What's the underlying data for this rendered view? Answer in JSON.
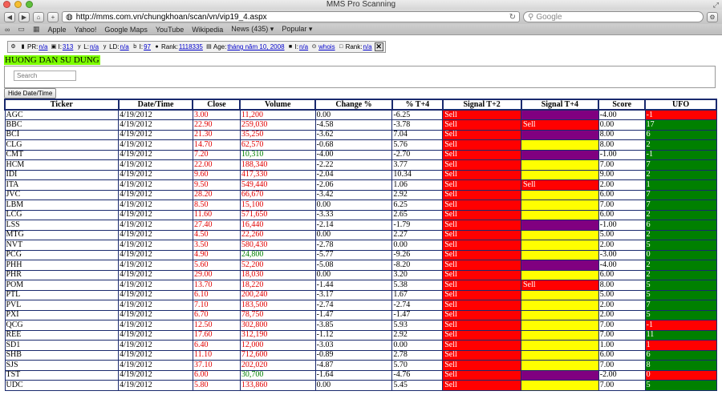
{
  "window": {
    "title": "MMS Pro Scanning"
  },
  "browser": {
    "url": "http://mms.com.vn/chungkhoan/scan/vn/vip19_4.aspx",
    "search_placeholder": "Google",
    "bookmarks": [
      "Apple",
      "Yahoo!",
      "Google Maps",
      "YouTube",
      "Wikipedia",
      "News (435)",
      "Popular"
    ]
  },
  "alexa": {
    "pr_label": "PR:",
    "pr_value": "n/a",
    "l1_label": "I:",
    "l1_value": "313",
    "l2_label": "L:",
    "l2_value": "n/a",
    "ld_label": "LD:",
    "ld_value": "n/a",
    "i_label": "I:",
    "i_value": "97",
    "rank_label": "Rank:",
    "rank_value": "1118335",
    "age_label": "Age:",
    "age_value": "tháng năm 10, 2008",
    "i2_label": "I:",
    "i2_value": "n/a",
    "whois": "whois",
    "rank2_label": "Rank:",
    "rank2_value": "n/a"
  },
  "page": {
    "guide_title": "HUONG DAN SU DUNG",
    "search_placeholder": "Search",
    "hide_button": "Hide Date/Time"
  },
  "table": {
    "headers": [
      "Ticker",
      "Date/Time",
      "Close",
      "Volume",
      "Change %",
      "% T+4",
      "Signal T+2",
      "Signal T+4",
      "Score",
      "UFO"
    ],
    "rows": [
      {
        "ticker": "AGC",
        "date": "4/19/2012",
        "close": "3.00",
        "close_color": "red",
        "volume": "11,200",
        "volume_color": "red",
        "change": "0.00",
        "t4": "-6.25",
        "sig2": "Sell",
        "sig2_bg": "red",
        "sig4": "",
        "sig4_bg": "purple",
        "score": "-4.00",
        "ufo": "-1",
        "ufo_bg": "red"
      },
      {
        "ticker": "BBC",
        "date": "4/19/2012",
        "close": "22.90",
        "close_color": "red",
        "volume": "259,030",
        "volume_color": "red",
        "change": "-4.58",
        "t4": "-3.78",
        "sig2": "Sell",
        "sig2_bg": "red",
        "sig4": "Sell",
        "sig4_bg": "red",
        "score": "0.00",
        "ufo": "17",
        "ufo_bg": "green"
      },
      {
        "ticker": "BCI",
        "date": "4/19/2012",
        "close": "21.30",
        "close_color": "red",
        "volume": "35,250",
        "volume_color": "red",
        "change": "-3.62",
        "t4": "7.04",
        "sig2": "Sell",
        "sig2_bg": "red",
        "sig4": "",
        "sig4_bg": "purple",
        "score": "8.00",
        "ufo": "6",
        "ufo_bg": "green"
      },
      {
        "ticker": "CLG",
        "date": "4/19/2012",
        "close": "14.70",
        "close_color": "red",
        "volume": "62,570",
        "volume_color": "red",
        "change": "-0.68",
        "t4": "5.76",
        "sig2": "Sell",
        "sig2_bg": "red",
        "sig4": "",
        "sig4_bg": "yellow",
        "score": "8.00",
        "ufo": "2",
        "ufo_bg": "green"
      },
      {
        "ticker": "CMT",
        "date": "4/19/2012",
        "close": "7.20",
        "close_color": "red",
        "volume": "10,310",
        "volume_color": "green",
        "change": "-4.00",
        "t4": "-2.70",
        "sig2": "Sell",
        "sig2_bg": "red",
        "sig4": "",
        "sig4_bg": "purple",
        "score": "-1.00",
        "ufo": "-1",
        "ufo_bg": "green"
      },
      {
        "ticker": "HCM",
        "date": "4/19/2012",
        "close": "22.00",
        "close_color": "red",
        "volume": "188,340",
        "volume_color": "red",
        "change": "-2.22",
        "t4": "3.77",
        "sig2": "Sell",
        "sig2_bg": "red",
        "sig4": "",
        "sig4_bg": "yellow",
        "score": "7.00",
        "ufo": "7",
        "ufo_bg": "green"
      },
      {
        "ticker": "IDI",
        "date": "4/19/2012",
        "close": "9.60",
        "close_color": "red",
        "volume": "417,330",
        "volume_color": "red",
        "change": "-2.04",
        "t4": "10.34",
        "sig2": "Sell",
        "sig2_bg": "red",
        "sig4": "",
        "sig4_bg": "yellow",
        "score": "9.00",
        "ufo": "2",
        "ufo_bg": "green"
      },
      {
        "ticker": "ITA",
        "date": "4/19/2012",
        "close": "9.50",
        "close_color": "red",
        "volume": "549,440",
        "volume_color": "red",
        "change": "-2.06",
        "t4": "1.06",
        "sig2": "Sell",
        "sig2_bg": "red",
        "sig4": "Sell",
        "sig4_bg": "red",
        "score": "2.00",
        "ufo": "1",
        "ufo_bg": "green"
      },
      {
        "ticker": "JVC",
        "date": "4/19/2012",
        "close": "28.20",
        "close_color": "red",
        "volume": "66,670",
        "volume_color": "red",
        "change": "-3.42",
        "t4": "2.92",
        "sig2": "Sell",
        "sig2_bg": "red",
        "sig4": "",
        "sig4_bg": "yellow",
        "score": "6.00",
        "ufo": "7",
        "ufo_bg": "green"
      },
      {
        "ticker": "LBM",
        "date": "4/19/2012",
        "close": "8.50",
        "close_color": "red",
        "volume": "15,100",
        "volume_color": "red",
        "change": "0.00",
        "t4": "6.25",
        "sig2": "Sell",
        "sig2_bg": "red",
        "sig4": "",
        "sig4_bg": "yellow",
        "score": "7.00",
        "ufo": "7",
        "ufo_bg": "green"
      },
      {
        "ticker": "LCG",
        "date": "4/19/2012",
        "close": "11.60",
        "close_color": "red",
        "volume": "571,650",
        "volume_color": "red",
        "change": "-3.33",
        "t4": "2.65",
        "sig2": "Sell",
        "sig2_bg": "red",
        "sig4": "",
        "sig4_bg": "yellow",
        "score": "6.00",
        "ufo": "2",
        "ufo_bg": "green"
      },
      {
        "ticker": "LSS",
        "date": "4/19/2012",
        "close": "27.40",
        "close_color": "red",
        "volume": "16,440",
        "volume_color": "red",
        "change": "-2.14",
        "t4": "-1.79",
        "sig2": "Sell",
        "sig2_bg": "red",
        "sig4": "",
        "sig4_bg": "purple",
        "score": "-1.00",
        "ufo": "6",
        "ufo_bg": "green"
      },
      {
        "ticker": "MTG",
        "date": "4/19/2012",
        "close": "4.50",
        "close_color": "red",
        "volume": "22,260",
        "volume_color": "red",
        "change": "0.00",
        "t4": "2.27",
        "sig2": "Sell",
        "sig2_bg": "red",
        "sig4": "",
        "sig4_bg": "yellow",
        "score": "5.00",
        "ufo": "2",
        "ufo_bg": "green"
      },
      {
        "ticker": "NVT",
        "date": "4/19/2012",
        "close": "3.50",
        "close_color": "red",
        "volume": "580,430",
        "volume_color": "red",
        "change": "-2.78",
        "t4": "0.00",
        "sig2": "Sell",
        "sig2_bg": "red",
        "sig4": "",
        "sig4_bg": "yellow",
        "score": "2.00",
        "ufo": "5",
        "ufo_bg": "green"
      },
      {
        "ticker": "PCG",
        "date": "4/19/2012",
        "close": "4.90",
        "close_color": "red",
        "volume": "24,800",
        "volume_color": "green",
        "change": "-5.77",
        "t4": "-9.26",
        "sig2": "Sell",
        "sig2_bg": "red",
        "sig4": "",
        "sig4_bg": "yellow",
        "score": "-3.00",
        "ufo": "0",
        "ufo_bg": "green"
      },
      {
        "ticker": "PHH",
        "date": "4/19/2012",
        "close": "5.60",
        "close_color": "red",
        "volume": "52,200",
        "volume_color": "red",
        "change": "-5.08",
        "t4": "-8.20",
        "sig2": "Sell",
        "sig2_bg": "red",
        "sig4": "",
        "sig4_bg": "purple",
        "score": "-4.00",
        "ufo": "2",
        "ufo_bg": "green"
      },
      {
        "ticker": "PHR",
        "date": "4/19/2012",
        "close": "29.00",
        "close_color": "red",
        "volume": "18,030",
        "volume_color": "red",
        "change": "0.00",
        "t4": "3.20",
        "sig2": "Sell",
        "sig2_bg": "red",
        "sig4": "",
        "sig4_bg": "yellow",
        "score": "6.00",
        "ufo": "2",
        "ufo_bg": "green"
      },
      {
        "ticker": "POM",
        "date": "4/19/2012",
        "close": "13.70",
        "close_color": "red",
        "volume": "18,220",
        "volume_color": "red",
        "change": "-1.44",
        "t4": "5.38",
        "sig2": "Sell",
        "sig2_bg": "red",
        "sig4": "Sell",
        "sig4_bg": "red",
        "score": "8.00",
        "ufo": "5",
        "ufo_bg": "green"
      },
      {
        "ticker": "PTL",
        "date": "4/19/2012",
        "close": "6.10",
        "close_color": "red",
        "volume": "200,240",
        "volume_color": "red",
        "change": "-3.17",
        "t4": "1.67",
        "sig2": "Sell",
        "sig2_bg": "red",
        "sig4": "",
        "sig4_bg": "yellow",
        "score": "5.00",
        "ufo": "5",
        "ufo_bg": "green"
      },
      {
        "ticker": "PVL",
        "date": "4/19/2012",
        "close": "7.10",
        "close_color": "red",
        "volume": "183,500",
        "volume_color": "red",
        "change": "-2.74",
        "t4": "-2.74",
        "sig2": "Sell",
        "sig2_bg": "red",
        "sig4": "",
        "sig4_bg": "yellow",
        "score": "2.00",
        "ufo": "7",
        "ufo_bg": "green"
      },
      {
        "ticker": "PXI",
        "date": "4/19/2012",
        "close": "6.70",
        "close_color": "red",
        "volume": "78,750",
        "volume_color": "red",
        "change": "-1.47",
        "t4": "-1.47",
        "sig2": "Sell",
        "sig2_bg": "red",
        "sig4": "",
        "sig4_bg": "yellow",
        "score": "2.00",
        "ufo": "5",
        "ufo_bg": "green"
      },
      {
        "ticker": "QCG",
        "date": "4/19/2012",
        "close": "12.50",
        "close_color": "red",
        "volume": "302,800",
        "volume_color": "red",
        "change": "-3.85",
        "t4": "5.93",
        "sig2": "Sell",
        "sig2_bg": "red",
        "sig4": "",
        "sig4_bg": "yellow",
        "score": "7.00",
        "ufo": "-1",
        "ufo_bg": "red"
      },
      {
        "ticker": "REE",
        "date": "4/19/2012",
        "close": "17.60",
        "close_color": "red",
        "volume": "312,190",
        "volume_color": "red",
        "change": "-1.12",
        "t4": "2.92",
        "sig2": "Sell",
        "sig2_bg": "red",
        "sig4": "",
        "sig4_bg": "yellow",
        "score": "7.00",
        "ufo": "11",
        "ufo_bg": "green"
      },
      {
        "ticker": "SD1",
        "date": "4/19/2012",
        "close": "6.40",
        "close_color": "red",
        "volume": "12,000",
        "volume_color": "red",
        "change": "-3.03",
        "t4": "0.00",
        "sig2": "Sell",
        "sig2_bg": "red",
        "sig4": "",
        "sig4_bg": "yellow",
        "score": "1.00",
        "ufo": "1",
        "ufo_bg": "red"
      },
      {
        "ticker": "SHB",
        "date": "4/19/2012",
        "close": "11.10",
        "close_color": "red",
        "volume": "712,600",
        "volume_color": "red",
        "change": "-0.89",
        "t4": "2.78",
        "sig2": "Sell",
        "sig2_bg": "red",
        "sig4": "",
        "sig4_bg": "yellow",
        "score": "6.00",
        "ufo": "6",
        "ufo_bg": "green"
      },
      {
        "ticker": "SJS",
        "date": "4/19/2012",
        "close": "37.10",
        "close_color": "red",
        "volume": "202,020",
        "volume_color": "red",
        "change": "-4.87",
        "t4": "5.70",
        "sig2": "Sell",
        "sig2_bg": "red",
        "sig4": "",
        "sig4_bg": "yellow",
        "score": "7.00",
        "ufo": "8",
        "ufo_bg": "green"
      },
      {
        "ticker": "TST",
        "date": "4/19/2012",
        "close": "6.00",
        "close_color": "red",
        "volume": "30,700",
        "volume_color": "green",
        "change": "-1.64",
        "t4": "-4.76",
        "sig2": "Sell",
        "sig2_bg": "red",
        "sig4": "",
        "sig4_bg": "purple",
        "score": "-2.00",
        "ufo": "0",
        "ufo_bg": "red"
      },
      {
        "ticker": "UDC",
        "date": "4/19/2012",
        "close": "5.80",
        "close_color": "red",
        "volume": "133,860",
        "volume_color": "red",
        "change": "0.00",
        "t4": "5.45",
        "sig2": "Sell",
        "sig2_bg": "red",
        "sig4": "",
        "sig4_bg": "yellow",
        "score": "7.00",
        "ufo": "5",
        "ufo_bg": "green"
      }
    ]
  }
}
